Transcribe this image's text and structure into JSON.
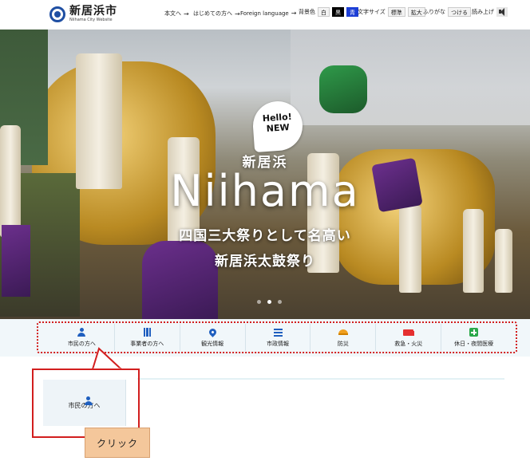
{
  "header": {
    "logo_title": "新居浜市",
    "logo_sub": "Niihama City Website",
    "links": [
      {
        "label": "本文へ",
        "arrow": "→"
      },
      {
        "label": "はじめての方へ",
        "arrow": "→"
      },
      {
        "label": "Foreign language",
        "arrow": "→"
      }
    ],
    "bg_color": {
      "label": "背景色",
      "options": [
        "白",
        "黒",
        "青"
      ]
    },
    "font_size": {
      "label": "文字サイズ",
      "options": [
        "標準",
        "拡大"
      ]
    },
    "furigana": {
      "label": "ふりがな",
      "button": "つける"
    },
    "read_aloud": {
      "label": "読み上げ"
    }
  },
  "hero": {
    "badge_line1": "Hello!",
    "badge_line2": "NEW",
    "city_jp": "新居浜",
    "city_en": "Niihama",
    "tagline1": "四国三大祭りとして名高い",
    "tagline2": "新居浜太鼓祭り",
    "slides_count": 3,
    "active_slide": 2
  },
  "categories": [
    {
      "label": "市民の方へ",
      "icon": "person-icon"
    },
    {
      "label": "事業者の方へ",
      "icon": "building-icon"
    },
    {
      "label": "観光情報",
      "icon": "map-pin-icon"
    },
    {
      "label": "市政情報",
      "icon": "list-icon"
    },
    {
      "label": "防災",
      "icon": "helmet-icon"
    },
    {
      "label": "救急・火災",
      "icon": "ambulance-icon"
    },
    {
      "label": "休日・夜間医療",
      "icon": "medical-kit-icon"
    }
  ],
  "callout": {
    "card_label": "市民の方へ",
    "click_label": "クリック"
  },
  "colors": {
    "accent_blue": "#1f5fbf",
    "highlight_red": "#d21e1e",
    "callout_orange": "#f4c79b",
    "nav_bg": "#f1f7fa"
  }
}
